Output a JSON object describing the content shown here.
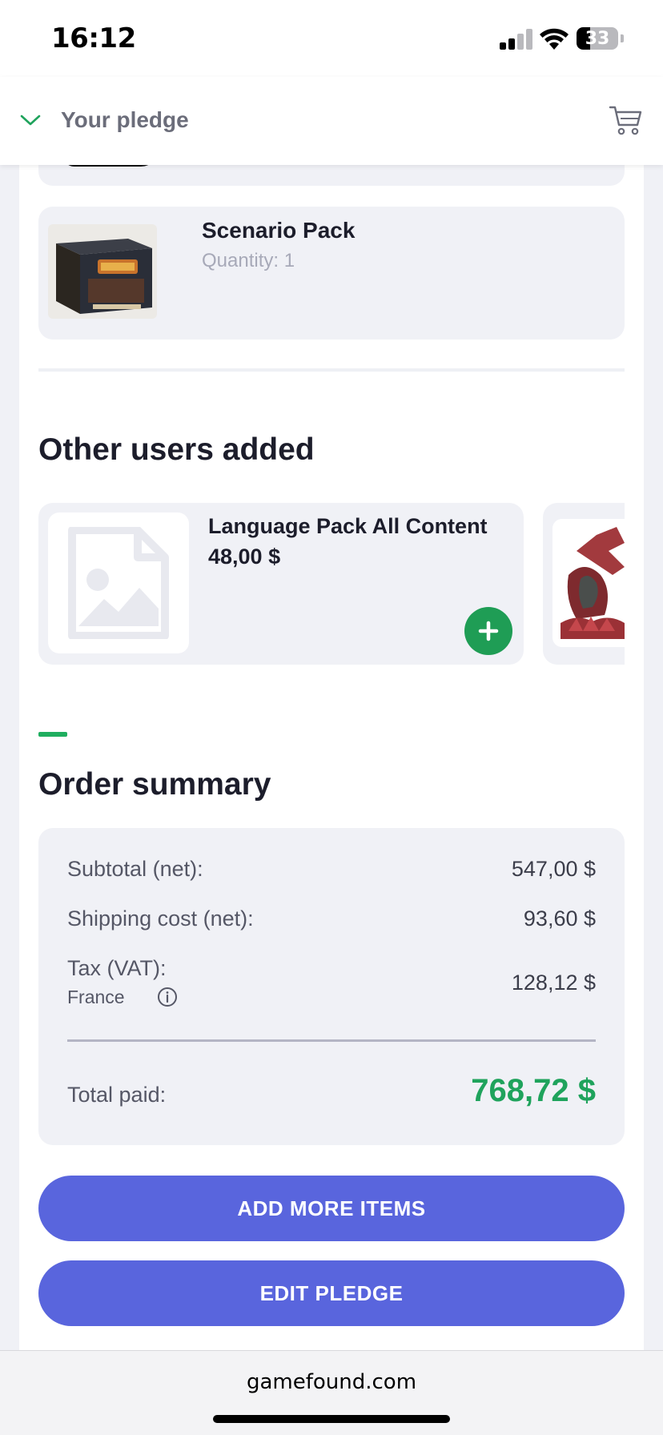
{
  "status_bar": {
    "time": "16:12",
    "battery": "33",
    "battery_level_percent": 33
  },
  "header": {
    "title": "Your pledge",
    "toggle_icon": "chevron-down-icon",
    "cart_icon": "cart-icon"
  },
  "pledge_items": [
    {
      "name": "Scenario Pack",
      "quantity_label": "Quantity: 1"
    }
  ],
  "recommendations": {
    "title": "Other users added",
    "items": [
      {
        "name": "Language Pack All Content",
        "price": "48,00 $",
        "image_icon": "image-placeholder-icon",
        "add_icon": "plus-icon"
      }
    ]
  },
  "order_summary": {
    "title": "Order summary",
    "subtotal_label": "Subtotal (net):",
    "subtotal_value": "547,00 $",
    "shipping_label": "Shipping cost (net):",
    "shipping_value": "93,60 $",
    "tax_label": "Tax (VAT):",
    "tax_country": "France",
    "tax_value": "128,12 $",
    "total_label": "Total paid:",
    "total_value": "768,72 $"
  },
  "actions": {
    "add_more": "ADD MORE ITEMS",
    "edit_pledge": "EDIT PLEDGE"
  },
  "browser": {
    "url": "gamefound.com"
  },
  "colors": {
    "accent_green": "#1fa35c",
    "primary_button": "#5965dd",
    "card_background": "#f0f1f6"
  }
}
